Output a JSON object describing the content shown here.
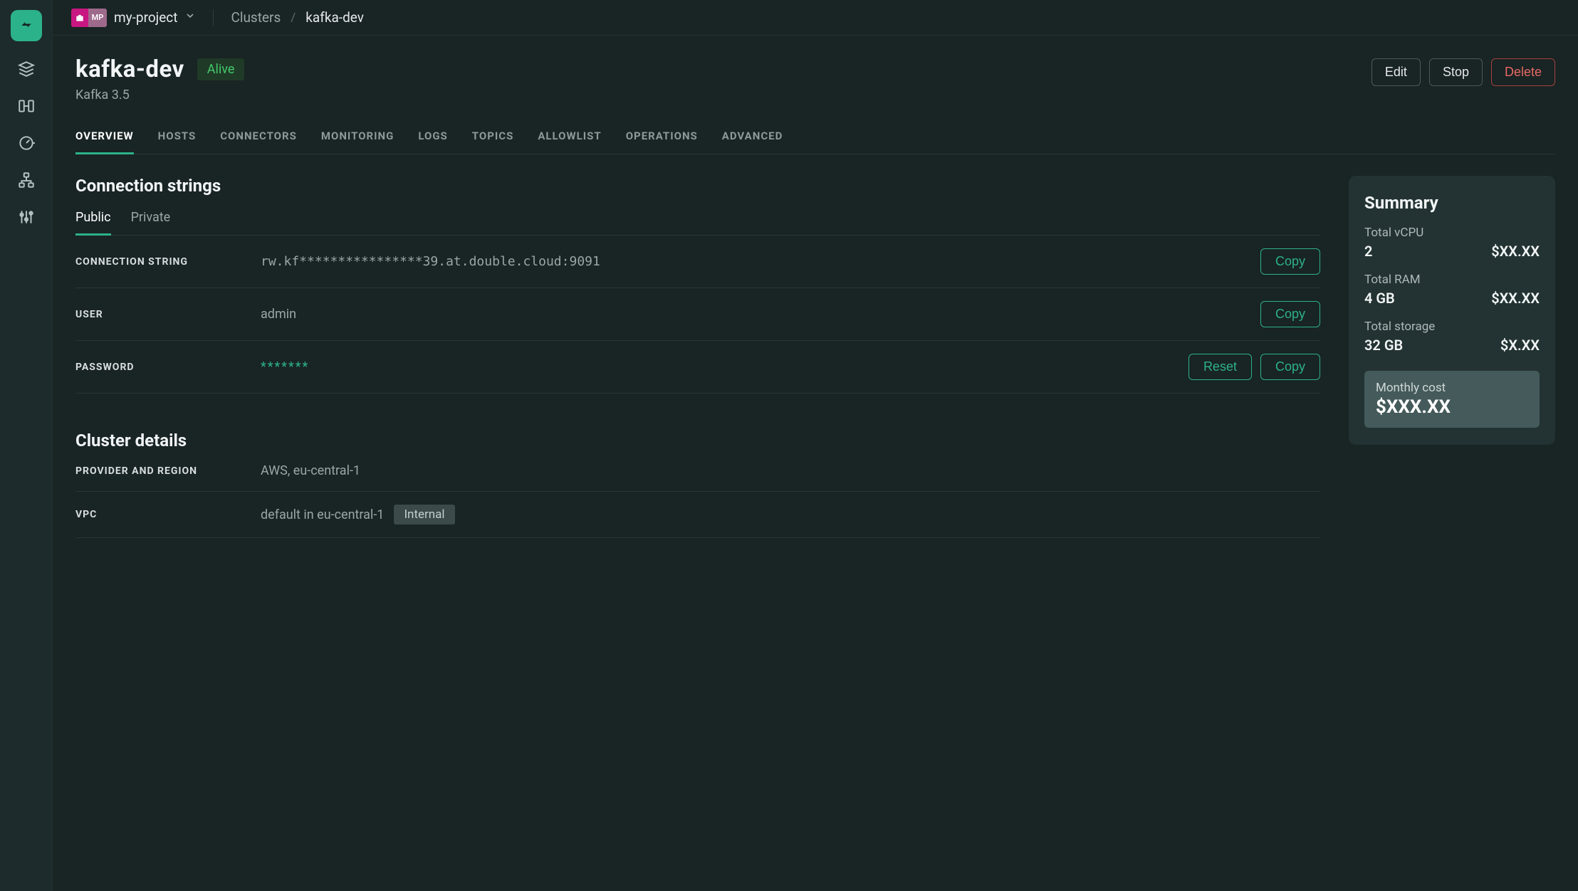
{
  "rail": {
    "items": [
      "clusters-icon",
      "transfer-icon",
      "meter-icon",
      "network-icon",
      "sliders-icon"
    ]
  },
  "project": {
    "badge": "MP",
    "name": "my-project"
  },
  "breadcrumb": {
    "parent": "Clusters",
    "current": "kafka-dev"
  },
  "cluster": {
    "name": "kafka-dev",
    "status": "Alive",
    "version": "Kafka 3.5"
  },
  "actions": {
    "edit": "Edit",
    "stop": "Stop",
    "delete": "Delete"
  },
  "tabs": [
    "OVERVIEW",
    "HOSTS",
    "CONNECTORS",
    "MONITORING",
    "LOGS",
    "TOPICS",
    "ALLOWLIST",
    "OPERATIONS",
    "ADVANCED"
  ],
  "active_tab": "OVERVIEW",
  "connection": {
    "title": "Connection strings",
    "subtabs": [
      "Public",
      "Private"
    ],
    "active_subtab": "Public",
    "rows": {
      "conn": {
        "label": "CONNECTION STRING",
        "value": "rw.kf****************39.at.double.cloud:9091",
        "copy": "Copy"
      },
      "user": {
        "label": "USER",
        "value": "admin",
        "copy": "Copy"
      },
      "password": {
        "label": "PASSWORD",
        "value": "*******",
        "reset": "Reset",
        "copy": "Copy"
      }
    }
  },
  "details": {
    "title": "Cluster details",
    "rows": {
      "provider": {
        "label": "PROVIDER AND REGION",
        "value": "AWS, eu-central-1"
      },
      "vpc": {
        "label": "VPC",
        "link": "default in eu-central-1",
        "tag": "Internal"
      }
    }
  },
  "summary": {
    "title": "Summary",
    "vcpu": {
      "label": "Total vCPU",
      "value": "2",
      "price": "$XX.XX"
    },
    "ram": {
      "label": "Total RAM",
      "value": "4 GB",
      "price": "$XX.XX"
    },
    "storage": {
      "label": "Total storage",
      "value": "32 GB",
      "price": "$X.XX"
    },
    "cost": {
      "label": "Monthly cost",
      "value": "$XXX.XX"
    }
  }
}
